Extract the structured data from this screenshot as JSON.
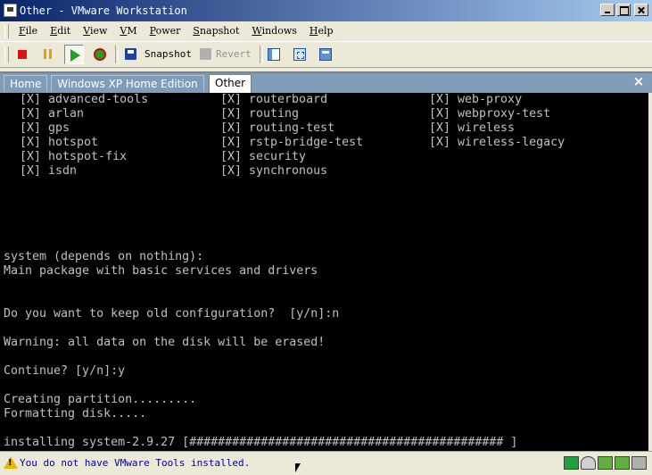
{
  "window": {
    "title": "Other - VMware Workstation"
  },
  "menu": [
    "File",
    "Edit",
    "View",
    "VM",
    "Power",
    "Snapshot",
    "Windows",
    "Help"
  ],
  "toolbar": {
    "snapshot_label": "Snapshot",
    "revert_label": "Revert"
  },
  "tabs": [
    {
      "label": "Home"
    },
    {
      "label": "Windows XP Home Edition"
    },
    {
      "label": "Other",
      "active": true
    }
  ],
  "console": {
    "packages": {
      "col1": [
        "[X] advanced-tools",
        "[X] arlan",
        "[X] gps",
        "[X] hotspot",
        "[X] hotspot-fix",
        "[X] isdn"
      ],
      "col2": [
        "[X] routerboard",
        "[X] routing",
        "[X] routing-test",
        "[X] rstp-bridge-test",
        "[X] security",
        "[X] synchronous"
      ],
      "col3": [
        "[X] web-proxy",
        "[X] webproxy-test",
        "[X] wireless",
        "[X] wireless-legacy"
      ]
    },
    "lines": [
      "system (depends on nothing):",
      "Main package with basic services and drivers",
      "Do you want to keep old configuration?  [y/n]:n",
      "Warning: all data on the disk will be erased!",
      "Continue? [y/n]:y",
      "Creating partition.........",
      "Formatting disk.....",
      "installing system-2.9.27 [############################################ ]"
    ]
  },
  "status": {
    "message": "You do not have VMware Tools installed."
  }
}
